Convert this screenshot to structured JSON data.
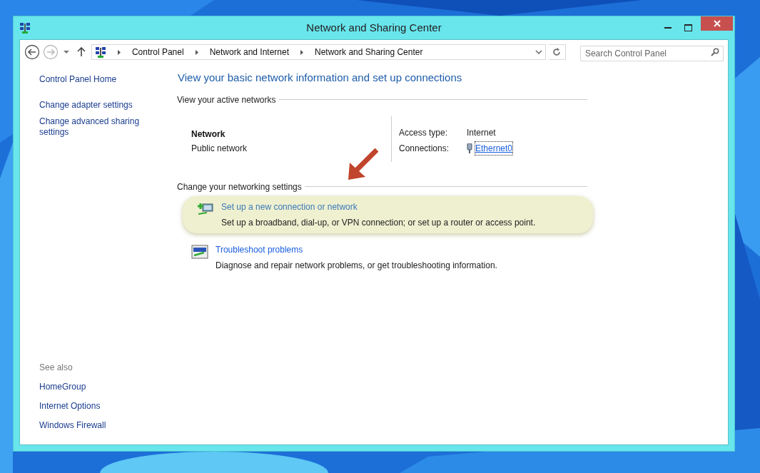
{
  "window": {
    "title": "Network and Sharing Center"
  },
  "nav": {
    "back_disabled": false,
    "forward_disabled": true
  },
  "breadcrumbs": [
    "Control Panel",
    "Network and Internet",
    "Network and Sharing Center"
  ],
  "search": {
    "placeholder": "Search Control Panel"
  },
  "sidebar": {
    "items": [
      "Control Panel Home",
      "Change adapter settings",
      "Change advanced sharing settings"
    ]
  },
  "see_also": {
    "heading": "See also",
    "links": [
      "HomeGroup",
      "Internet Options",
      "Windows Firewall"
    ]
  },
  "heading": "View your basic network information and set up connections",
  "active_networks": {
    "heading": "View your active networks",
    "name": "Network",
    "type": "Public network",
    "details": [
      {
        "label": "Access type:",
        "value": "Internet",
        "kind": "text"
      },
      {
        "label": "Connections:",
        "value": "Ethernet0",
        "kind": "link"
      }
    ]
  },
  "settings": {
    "heading": "Change your networking settings",
    "tasks": [
      {
        "title": "Set up a new connection or network",
        "description": "Set up a broadband, dial-up, or VPN connection; or set up a router or access point.",
        "highlighted": true,
        "kind": "connection"
      },
      {
        "title": "Troubleshoot problems",
        "description": "Diagnose and repair network problems, or get troubleshooting information.",
        "highlighted": false,
        "kind": "troubleshoot"
      }
    ]
  }
}
